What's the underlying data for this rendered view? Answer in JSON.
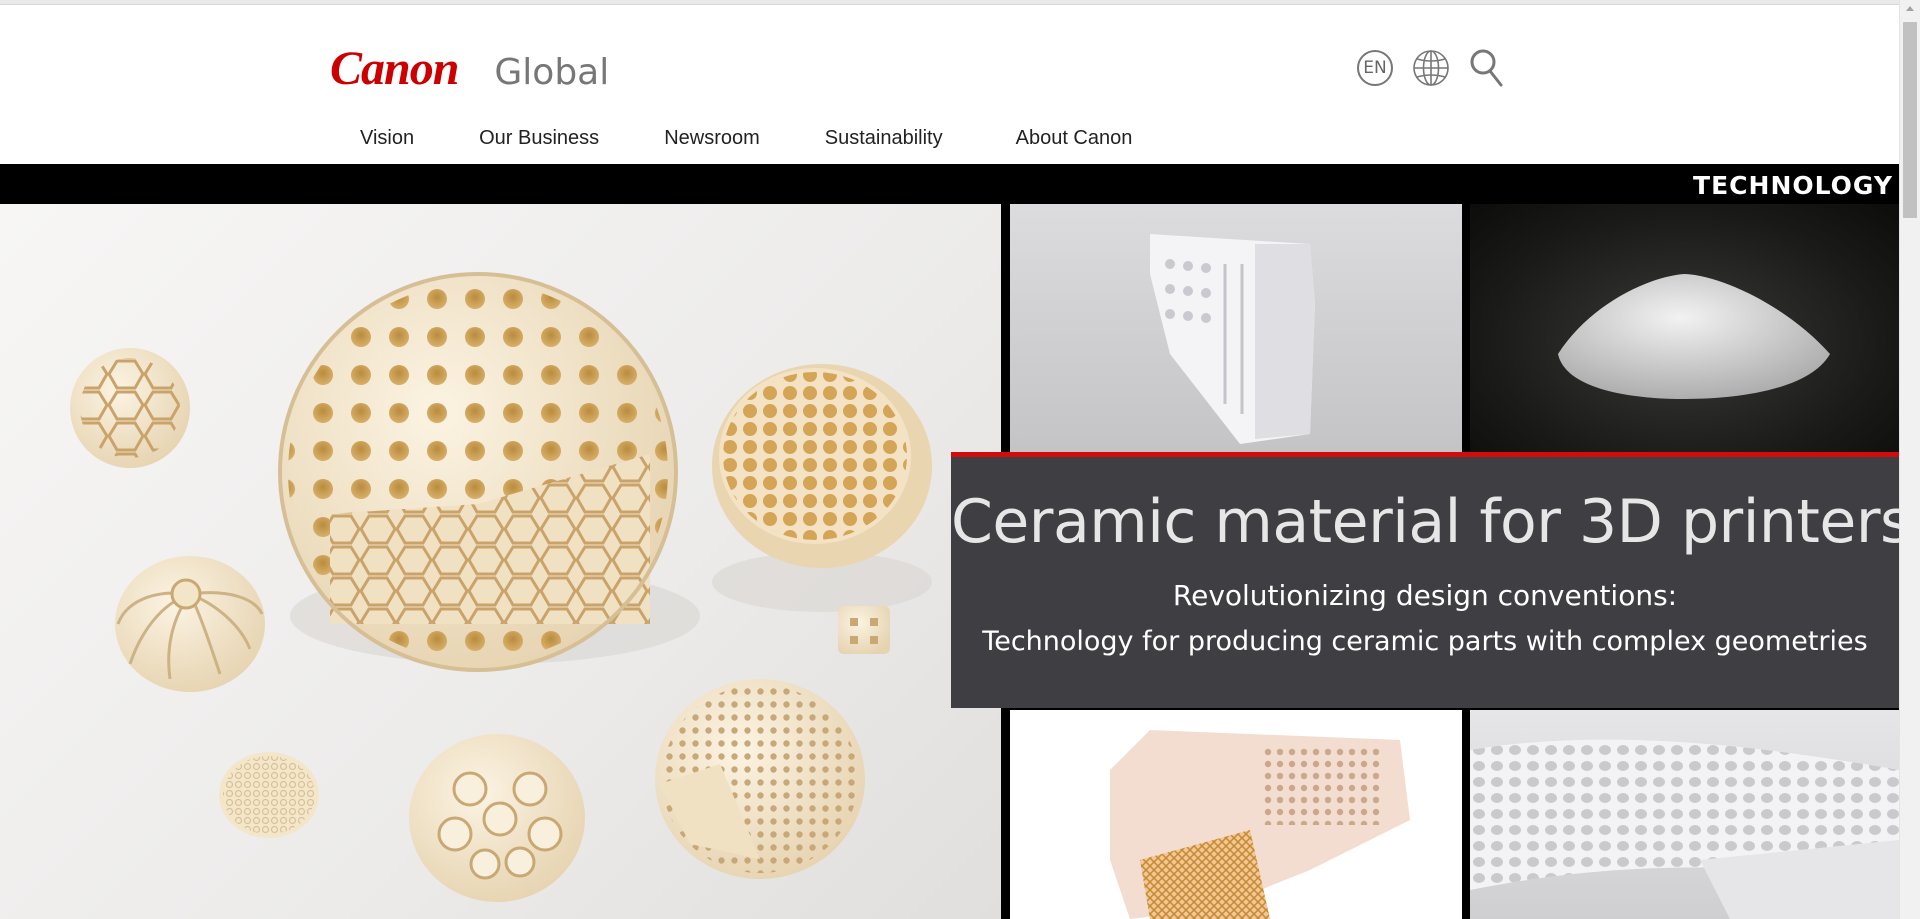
{
  "header": {
    "brand": "Canon",
    "site": "Global",
    "language": "EN",
    "utilities": [
      {
        "name": "language-selector-icon"
      },
      {
        "name": "globe-icon"
      },
      {
        "name": "search-icon"
      }
    ]
  },
  "nav": {
    "items": [
      {
        "label": "Vision"
      },
      {
        "label": "Our Business"
      },
      {
        "label": "Newsroom"
      },
      {
        "label": "Sustainability"
      },
      {
        "label": "About Canon"
      }
    ]
  },
  "banner": {
    "category": "TECHNOLOGY",
    "title": "Ceramic material for 3D printers",
    "subtitle_line1": "Revolutionizing design conventions:",
    "subtitle_line2": "Technology for producing ceramic parts with complex geometries",
    "colors": {
      "accent": "#d20c0c",
      "overlay": "#3f3e43",
      "brand_red": "#cc0000"
    }
  }
}
